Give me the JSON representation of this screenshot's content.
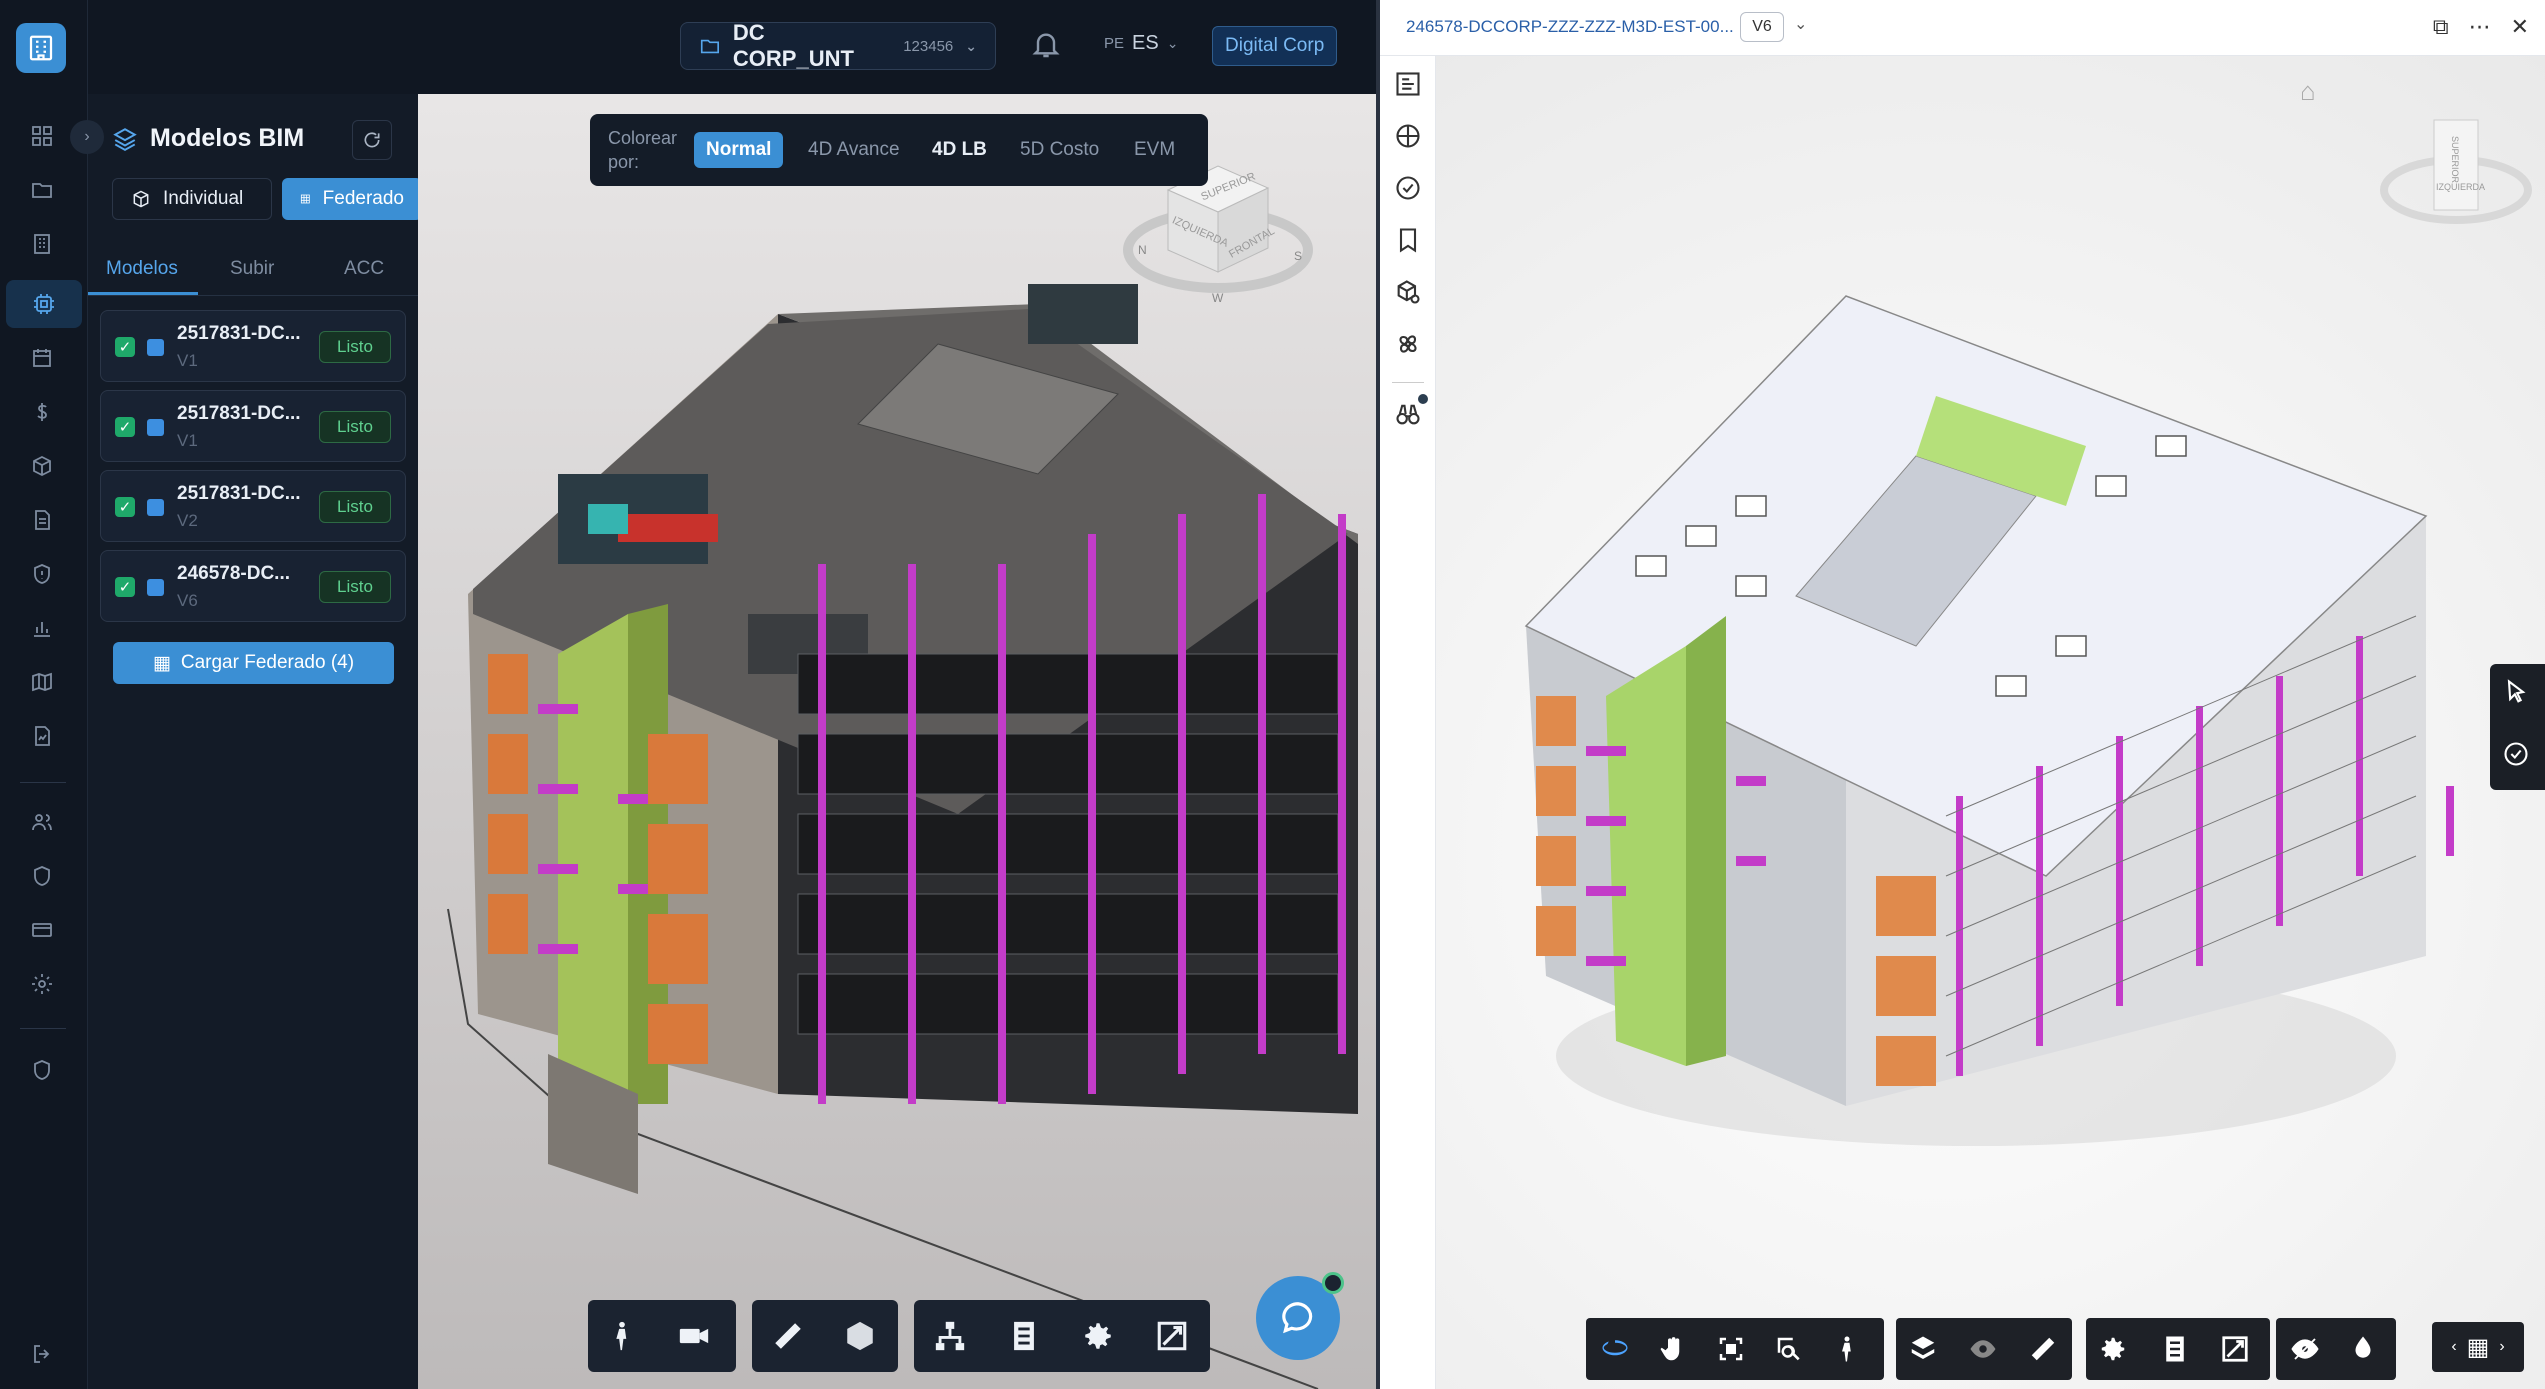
{
  "header": {
    "project_name": "DC CORP_UNT",
    "project_code": "123456",
    "lang_prefix": "PE",
    "lang": "ES",
    "org": "Digital Corp"
  },
  "panel": {
    "title": "Modelos BIM",
    "mode_individual": "Individual",
    "mode_federado": "Federado",
    "tabs": [
      "Modelos",
      "Subir",
      "ACC"
    ],
    "models": [
      {
        "name": "2517831-DC...",
        "version": "V1",
        "status": "Listo"
      },
      {
        "name": "2517831-DC...",
        "version": "V1",
        "status": "Listo"
      },
      {
        "name": "2517831-DC...",
        "version": "V2",
        "status": "Listo"
      },
      {
        "name": "246578-DC...",
        "version": "V6",
        "status": "Listo"
      }
    ],
    "load_button": "Cargar Federado (4)"
  },
  "colorbar": {
    "label": "Colorear por:",
    "options": [
      "Normal",
      "4D Avance",
      "4D LB",
      "5D Costo",
      "EVM"
    ],
    "selected": "Normal"
  },
  "viewcube_left": {
    "top": "SUPERIOR",
    "left": "IZQUIERDA",
    "front": "FRONTAL"
  },
  "viewcube_right": {
    "top": "SUPERIOR",
    "left": "IZQUIERDA"
  },
  "acc_viewer": {
    "file_name": "246578-DCCORP-ZZZ-ZZZ-M3D-EST-00...",
    "version": "V6"
  },
  "colors": {
    "accent": "#3b8fd4",
    "dark_bg": "#101722",
    "ready_green": "#5fd08f",
    "magenta": "#c33cc8",
    "lime": "#9ccb62",
    "orange": "#d9793b"
  }
}
